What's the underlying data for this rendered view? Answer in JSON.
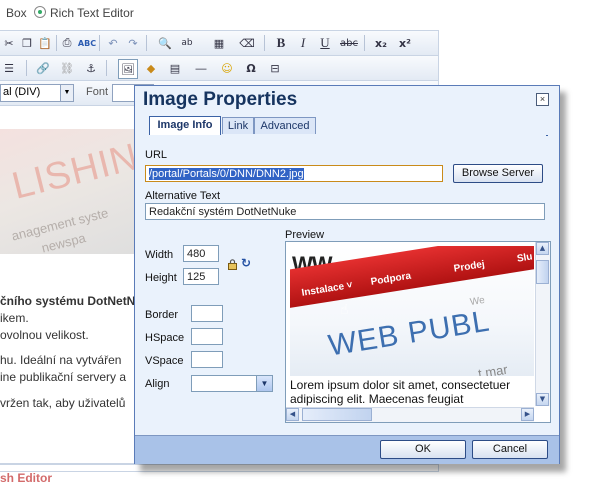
{
  "editor_mode": {
    "left_label": "Box",
    "right_label": "Rich Text Editor"
  },
  "toolbar": {
    "row1": [
      "cut-icon",
      "copy-icon",
      "paste-icon",
      "paste-text-icon",
      "print-icon",
      "spellcheck-icon",
      "undo-icon",
      "redo-icon",
      "find-icon",
      "replace-icon",
      "select-all-icon",
      "remove-format-icon",
      "bold-icon",
      "italic-icon",
      "underline-icon",
      "strikethrough-icon",
      "subscript-icon",
      "superscript-icon"
    ],
    "bold": "B",
    "italic": "I",
    "underline": "U",
    "strike": "abc",
    "subscript": "x₂",
    "superscript": "x²",
    "style_value": "al (DIV)",
    "font_label": "Font"
  },
  "document": {
    "banner_title": "LISHING",
    "banner_sub1": "anagement syste",
    "banner_sub2": "newspa",
    "lines": [
      {
        "text": "čního systému DotNetN",
        "bold": true
      },
      {
        "text": "ikem.",
        "bold": false
      },
      {
        "text": "ovolnou velikost.",
        "bold": false
      },
      {
        "text": "hu. Ideální na vytvářen",
        "bold": false,
        "bold_prefix": "hu."
      },
      {
        "text": "ine publikační servery a",
        "bold": false
      },
      {
        "text": "vržen tak, aby uživatelů",
        "bold": false
      }
    ],
    "footer_title": "sh Editor"
  },
  "dialog": {
    "title": "Image Properties",
    "close": "×",
    "tabs": [
      {
        "label": "Image Info",
        "active": true
      },
      {
        "label": "Link",
        "active": false
      },
      {
        "label": "Advanced",
        "active": false
      }
    ],
    "url_label": "URL",
    "url_value": "/portal/Portals/0/DNN/DNN2.jpg",
    "browse_button": "Browse Server",
    "alt_label": "Alternative Text",
    "alt_value": "Redakční systém DotNetNuke",
    "width_label": "Width",
    "width_value": "480",
    "height_label": "Height",
    "height_value": "125",
    "border_label": "Border",
    "border_value": "",
    "hspace_label": "HSpace",
    "hspace_value": "",
    "vspace_label": "VSpace",
    "vspace_value": "",
    "align_label": "Align",
    "align_value": "",
    "preview_label": "Preview",
    "preview_image": {
      "logo": "WW",
      "nav": [
        "Instalace ˅",
        "Podpora",
        "Prodej",
        "Slu"
      ],
      "headline": "WEB PUBL",
      "small_top": "We",
      "small_bottom": "t mar"
    },
    "preview_text": "Lorem ipsum dolor sit amet, consectetuer adipiscing elit. Maecenas feugiat",
    "ok_button": "OK",
    "cancel_button": "Cancel"
  },
  "colors": {
    "dialog_bg": "#eaf2fc",
    "dialog_title": "#16345f",
    "footer_bar": "#a9c2e8",
    "accent_red": "#d36b6b"
  }
}
